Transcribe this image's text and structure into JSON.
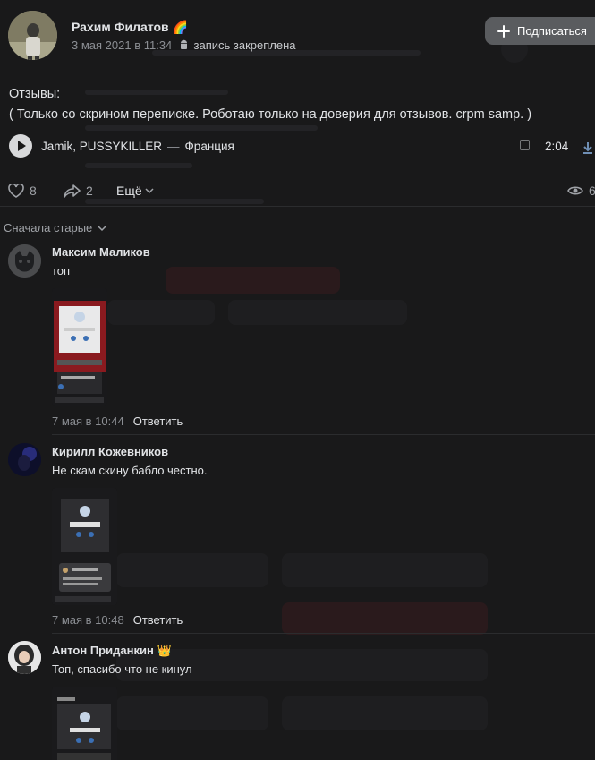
{
  "post": {
    "author": "Рахим Филатов",
    "author_badge": "🌈",
    "date": "3 мая 2021 в 11:34",
    "pinned": "запись закреплена",
    "subscribe_label": "Подписаться",
    "text_line1": "Отзывы:",
    "text_line2": "( Только со скрином переписке. Роботаю только на доверия для отзывов. crpm samp. )",
    "audio": {
      "artist": "Jamik, PUSSYKILLER",
      "separator": "—",
      "title": "Франция",
      "duration": "2:04"
    },
    "likes": "8",
    "shares": "2",
    "more_label": "Ещё",
    "views": "6"
  },
  "sort_label": "Сначала старые",
  "comments": [
    {
      "author": "Максим Маликов",
      "badge": "",
      "text": "топ",
      "date": "7 мая в 10:44",
      "reply": "Ответить"
    },
    {
      "author": "Кирилл Кожевников",
      "badge": "",
      "text": "Не скам скину бабло честно.",
      "date": "7 мая в 10:48",
      "reply": "Ответить"
    },
    {
      "author": "Антон Приданкин",
      "badge": "👑",
      "text": "Топ, спасибо что не кинул",
      "date": "",
      "reply": ""
    }
  ],
  "colors": {
    "background": "#19191a",
    "text": "#e1e3e6",
    "muted": "#8b8e93",
    "button": "#5a5c5f",
    "accent": "#6f8fb5"
  },
  "icons": [
    "play-icon",
    "android-icon",
    "plus-icon",
    "lyrics-icon",
    "download-icon",
    "heart-icon",
    "share-icon",
    "chevron-down-icon",
    "eye-icon"
  ]
}
